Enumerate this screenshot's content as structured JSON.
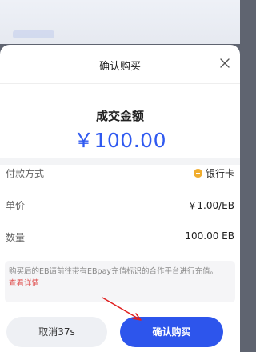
{
  "sheet": {
    "title": "确认购买",
    "amount_label": "成交金额",
    "amount_value": "￥100.00"
  },
  "details": [
    {
      "label": "付款方式",
      "value": "银行卡",
      "icon": "coin-icon"
    },
    {
      "label": "单价",
      "value": "￥1.00/EB"
    },
    {
      "label": "数量",
      "value": "100.00 EB"
    }
  ],
  "notice": {
    "text": "购买后的EB请前往带有EBpay充值标识的合作平台进行充值。",
    "link": "查看详情"
  },
  "buttons": {
    "cancel": "取消37s",
    "confirm": "确认购买"
  },
  "colors": {
    "accent": "#2d55ec",
    "amount": "#2f59f0",
    "link": "#e05252",
    "annotation_arrow": "#e02020"
  }
}
